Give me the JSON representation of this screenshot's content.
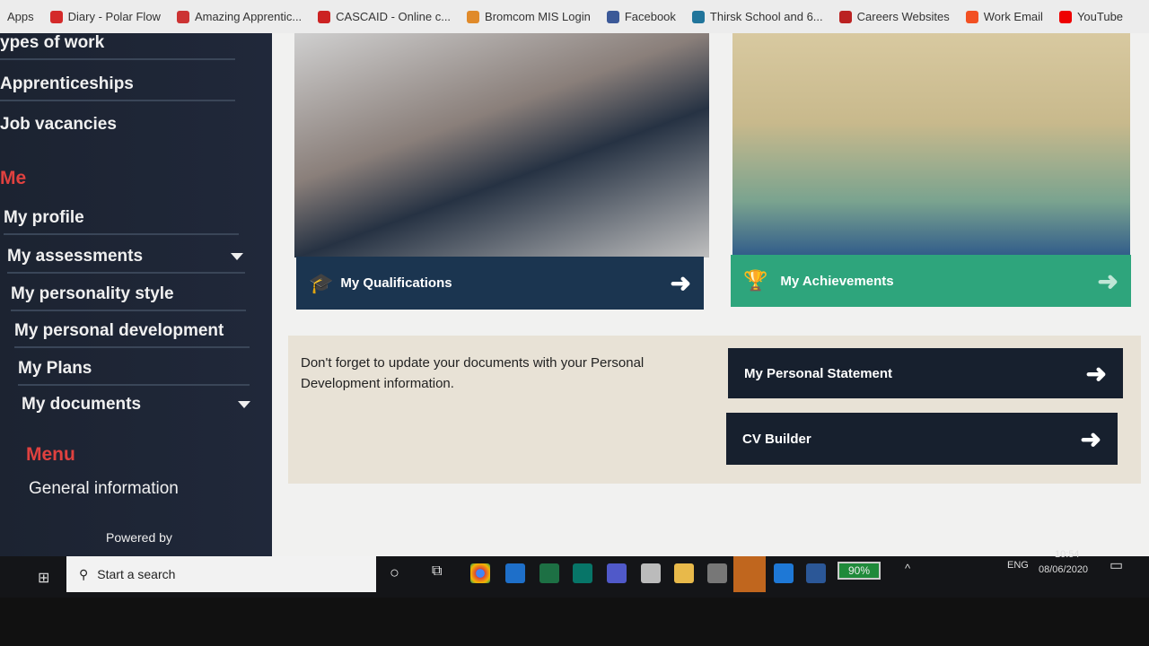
{
  "bookmarks": [
    {
      "label": "Apps",
      "color": "#ececec"
    },
    {
      "label": "Diary - Polar Flow",
      "color": "#d42a2a"
    },
    {
      "label": "Amazing Apprentic...",
      "color": "#c33"
    },
    {
      "label": "CASCAID - Online c...",
      "color": "#c22"
    },
    {
      "label": "Bromcom MIS Login",
      "color": "#e08a2a"
    },
    {
      "label": "Facebook",
      "color": "#3b5998"
    },
    {
      "label": "Thirsk School and 6...",
      "color": "#21759b"
    },
    {
      "label": "Careers Websites",
      "color": "#b22"
    },
    {
      "label": "Work Email",
      "color": "#f25022"
    },
    {
      "label": "YouTube",
      "color": "#e00"
    }
  ],
  "sidebar": {
    "items_top": [
      "ypes of work",
      "Apprenticeships",
      "Job vacancies"
    ],
    "me_heading": "Me",
    "me_items": [
      "My profile",
      "My assessments",
      "My personality style",
      "My personal development",
      "My Plans",
      "My documents"
    ],
    "menu_heading": "Menu",
    "menu_items": [
      "General information"
    ],
    "powered_by": "Powered by"
  },
  "main": {
    "qualifications": "My Qualifications",
    "achievements": "My Achievements",
    "reminder": "Don't forget to update your documents with your Personal Development information.",
    "personal_statement": "My Personal Statement",
    "cv_builder": "CV Builder",
    "arrow": "➜"
  },
  "taskbar": {
    "search_placeholder": "Start a search",
    "battery": "90%",
    "lang": "ENG",
    "time": "10:54",
    "date": "08/06/2020"
  }
}
